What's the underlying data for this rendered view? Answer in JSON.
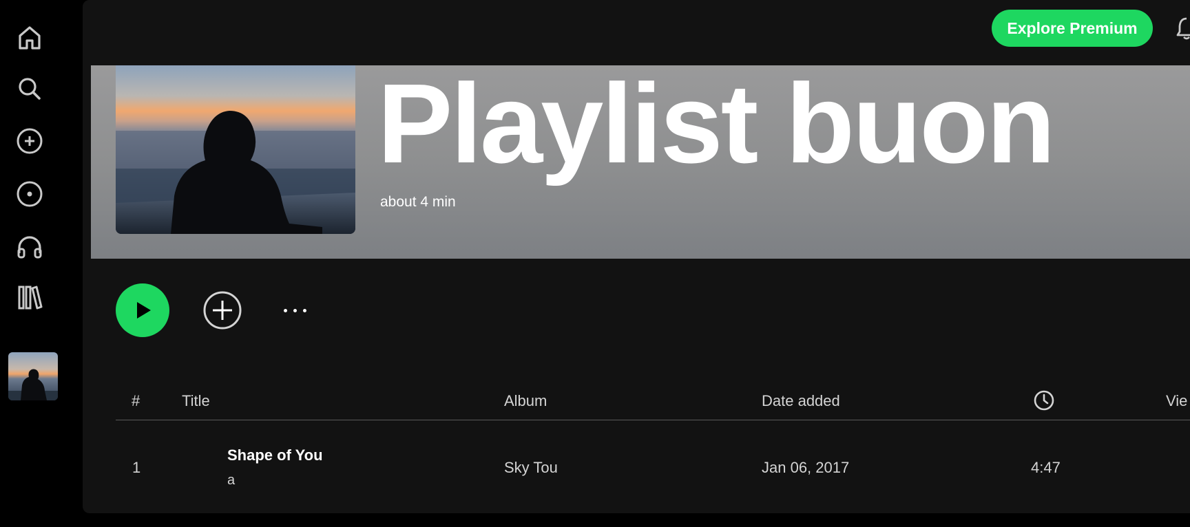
{
  "sidebar": {
    "items": [
      {
        "icon": "home-icon"
      },
      {
        "icon": "search-icon"
      },
      {
        "icon": "plus-circle-icon"
      },
      {
        "icon": "disc-icon"
      },
      {
        "icon": "headphones-icon"
      },
      {
        "icon": "library-icon"
      }
    ]
  },
  "header": {
    "premium_label": "Explore Premium"
  },
  "playlist": {
    "title": "Playlist buon",
    "duration": "about 4 min"
  },
  "table": {
    "columns": {
      "number": "#",
      "title": "Title",
      "album": "Album",
      "date_added": "Date added",
      "duration_icon": "clock-icon",
      "view": "Vie"
    },
    "rows": [
      {
        "number": "1",
        "title": "Shape of You",
        "artist": "a",
        "album": "Sky Tou",
        "date_added": "Jan 06, 2017",
        "duration": "4:47"
      }
    ]
  },
  "colors": {
    "accent": "#1ed760",
    "panel": "#121212",
    "background": "#000000",
    "banner": "#8e8f90"
  }
}
